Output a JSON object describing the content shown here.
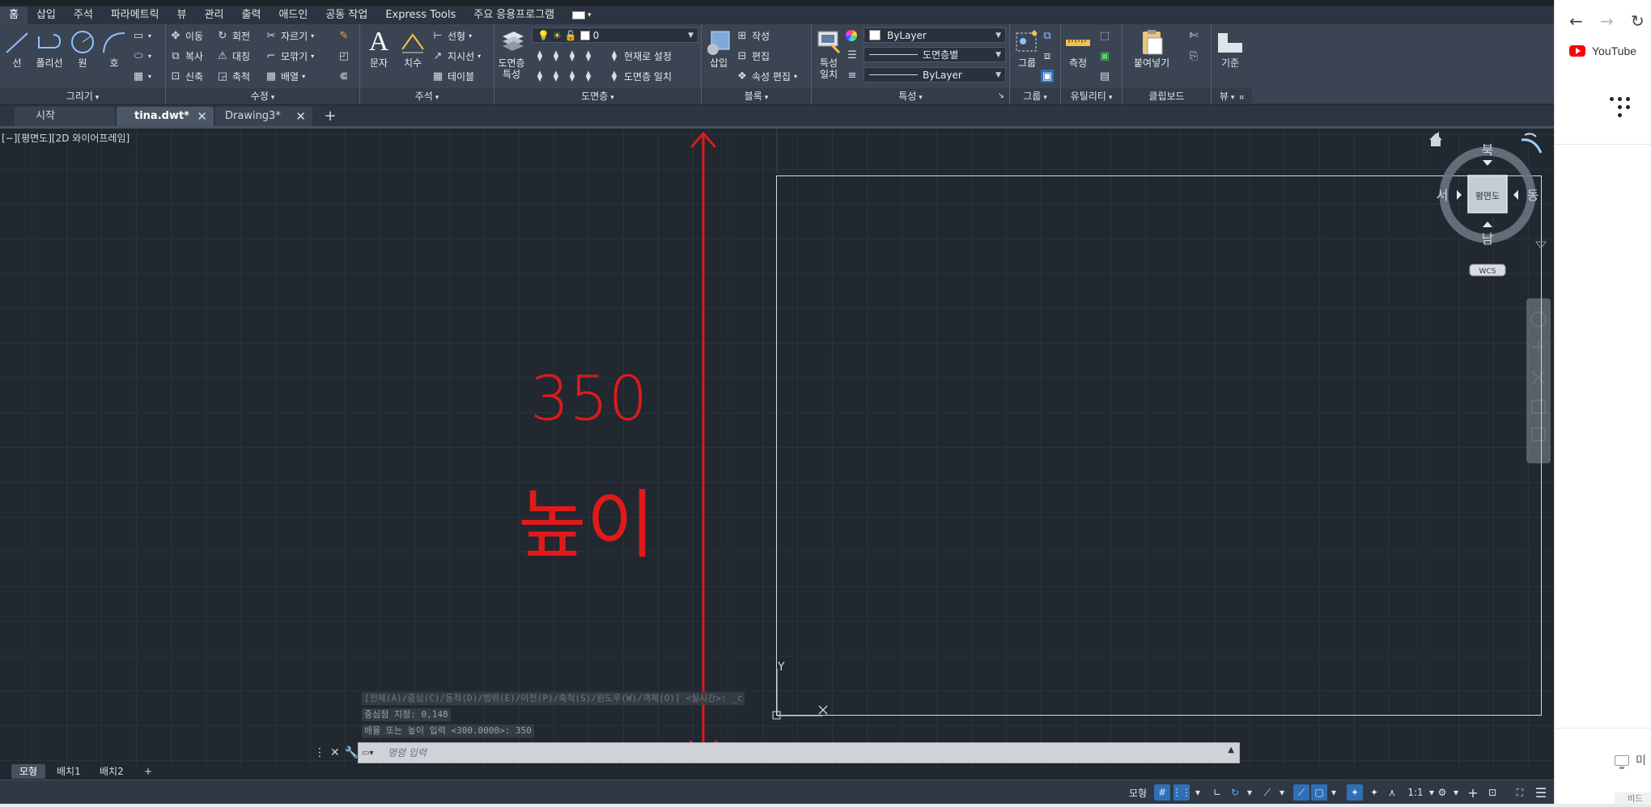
{
  "menu_tabs": [
    "홈",
    "삽입",
    "주석",
    "파라메트릭",
    "뷰",
    "관리",
    "출력",
    "애드인",
    "공동 작업",
    "Express Tools",
    "주요 응용프로그램"
  ],
  "ribbon": {
    "draw": {
      "title": "그리기",
      "line": "선",
      "polyline": "폴리선",
      "circle": "원",
      "arc": "호"
    },
    "modify": {
      "title": "수정",
      "move": "이동",
      "rotate": "회전",
      "trim": "자르기",
      "copy": "복사",
      "mirror": "대칭",
      "fillet": "모깎기",
      "stretch": "신축",
      "scale": "축척",
      "array": "배열"
    },
    "annotation": {
      "title": "주석",
      "text": "문자",
      "dimension": "치수",
      "linear": "선형",
      "leader": "지시선",
      "table": "테이블"
    },
    "layers": {
      "title": "도면층",
      "properties": "도면층\n특성",
      "current_layer": "0",
      "make_current": "현재로 설정",
      "match_layer": "도면층 일치"
    },
    "block": {
      "title": "블록",
      "insert": "삽입",
      "create": "작성",
      "edit": "편집",
      "attr_edit": "속성 편집"
    },
    "properties": {
      "title": "특성",
      "match": "특성\n일치",
      "color": "ByLayer",
      "linetype": "도면층별",
      "lineweight": "ByLayer"
    },
    "groups": {
      "title": "그룹",
      "group": "그룹"
    },
    "utilities": {
      "title": "유틸리티",
      "measure": "측정"
    },
    "clipboard": {
      "title": "클립보드",
      "paste": "붙여넣기"
    },
    "view": {
      "title": "뷰",
      "base": "기준"
    }
  },
  "file_tabs": [
    {
      "label": "시작",
      "active": false,
      "closable": false
    },
    {
      "label": "tina.dwt*",
      "active": true,
      "closable": true
    },
    {
      "label": "Drawing3*",
      "active": false,
      "closable": true
    }
  ],
  "viewport": {
    "label": "[−][평면도][2D 와이어프레임]",
    "viewcube": {
      "north": "북",
      "south": "남",
      "west": "서",
      "east": "동",
      "face": "평면도",
      "wcs": "WCS"
    },
    "ucs_y": "Y",
    "annotation": {
      "number": "350",
      "word": "높이",
      "color": "#e01a1a"
    }
  },
  "command": {
    "history": [
      "[전체(A)/중심(C)/동적(D)/범위(E)/이전(P)/축척(S)/윈도우(W)/객체(O)] <실시간>: _c",
      "중심점 지정: 0,148",
      "배율 또는 높이 입력 <300.0000>: 350"
    ],
    "placeholder": "명령 입력"
  },
  "layout_tabs": [
    "모형",
    "배치1",
    "배치2"
  ],
  "status": {
    "model": "모형",
    "scale": "1:1"
  },
  "browser": {
    "youtube": "YouTube",
    "bottom_text": "미",
    "foot_text": "비드"
  }
}
